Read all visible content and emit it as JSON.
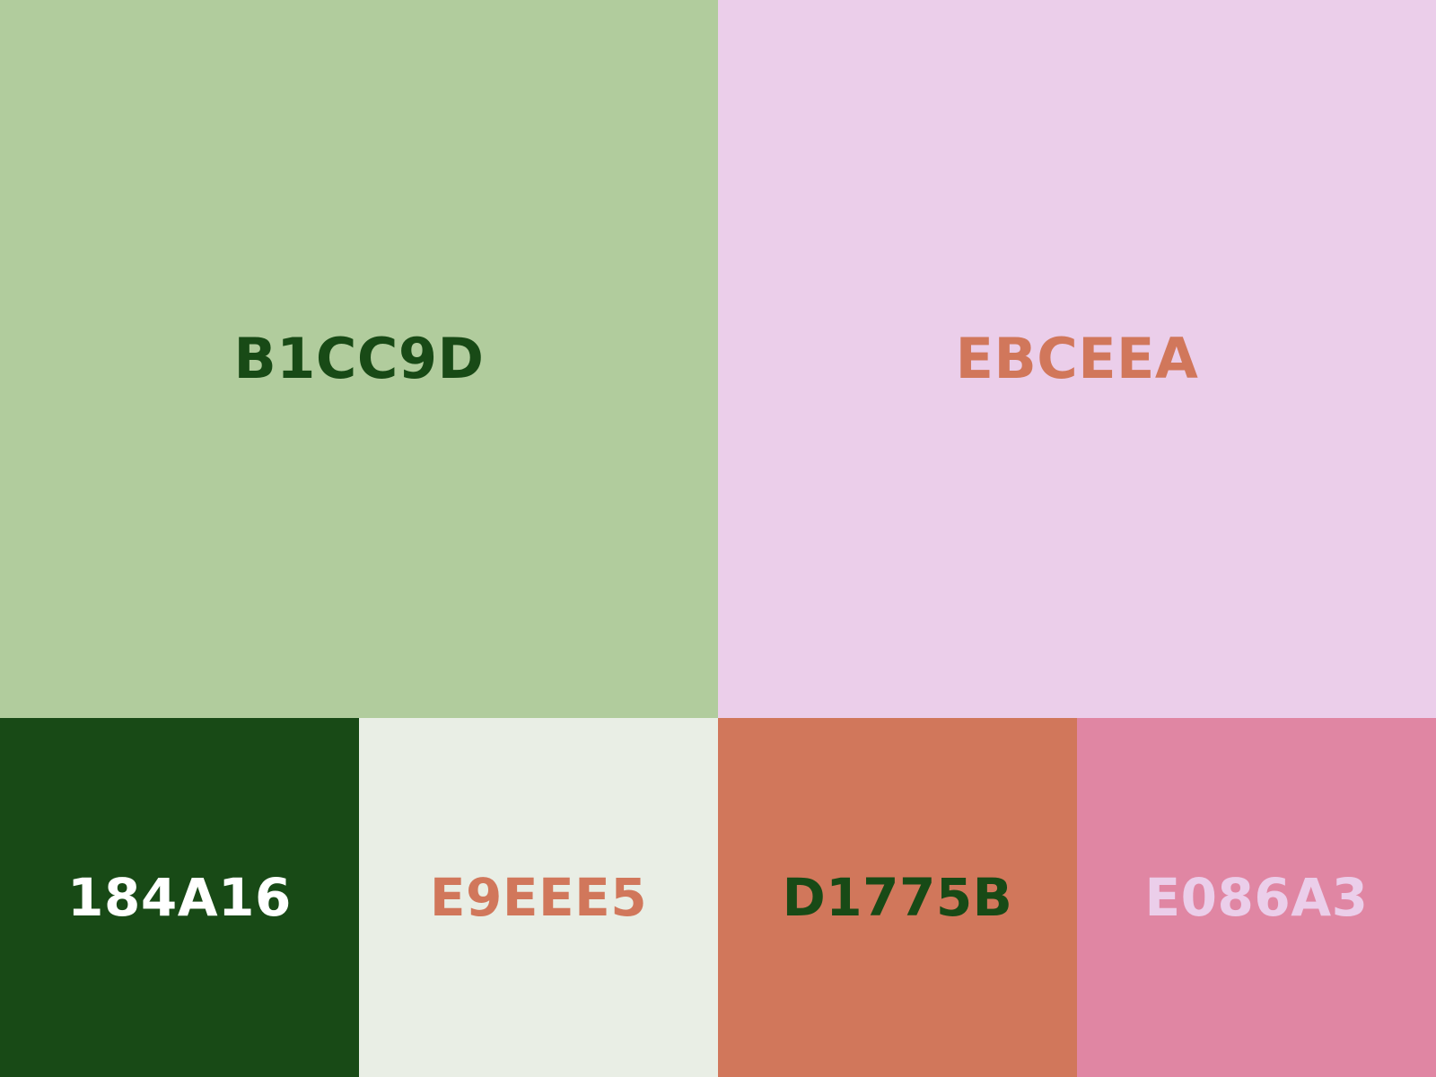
{
  "swatches": [
    {
      "label": "B1CC9D",
      "background": "#B1CC9D",
      "text_color": "#184A16"
    },
    {
      "label": "EBCEEA",
      "background": "#EBCEEA",
      "text_color": "#D1775B"
    },
    {
      "label": "184A16",
      "background": "#184A16",
      "text_color": "#FFFFFF"
    },
    {
      "label": "E9EEE5",
      "background": "#E9EEE5",
      "text_color": "#D1775B"
    },
    {
      "label": "D1775B",
      "background": "#D1775B",
      "text_color": "#184A16"
    },
    {
      "label": "E086A3",
      "background": "#E086A3",
      "text_color": "#EBCEEA"
    }
  ]
}
